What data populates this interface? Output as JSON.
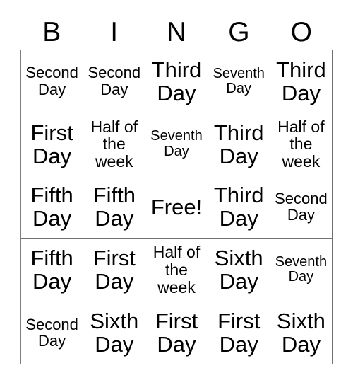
{
  "card": {
    "type": "bingo-card",
    "header_letters": [
      "B",
      "I",
      "N",
      "G",
      "O"
    ],
    "columns": 5,
    "rows": 5,
    "free_space_label": "Free!",
    "free_space_position": {
      "row": 3,
      "column": 3
    },
    "colors": {
      "background": "#ffffff",
      "text": "#000000",
      "grid_line": "#707070"
    },
    "cells": [
      [
        {
          "text": "Second Day",
          "size": "md"
        },
        {
          "text": "Second Day",
          "size": "md"
        },
        {
          "text": "Third Day",
          "size": "xl"
        },
        {
          "text": "Seventh Day",
          "size": "sm"
        },
        {
          "text": "Third Day",
          "size": "xl"
        }
      ],
      [
        {
          "text": "First Day",
          "size": "xl"
        },
        {
          "text": "Half of the week",
          "size": "lg"
        },
        {
          "text": "Seventh Day",
          "size": "sm"
        },
        {
          "text": "Third Day",
          "size": "xl"
        },
        {
          "text": "Half of the week",
          "size": "lg"
        }
      ],
      [
        {
          "text": "Fifth Day",
          "size": "xl"
        },
        {
          "text": "Fifth Day",
          "size": "xl"
        },
        {
          "text": "Free!",
          "size": "xl"
        },
        {
          "text": "Third Day",
          "size": "xl"
        },
        {
          "text": "Second Day",
          "size": "md"
        }
      ],
      [
        {
          "text": "Fifth Day",
          "size": "xl"
        },
        {
          "text": "First Day",
          "size": "xl"
        },
        {
          "text": "Half of the week",
          "size": "lg"
        },
        {
          "text": "Sixth Day",
          "size": "xl"
        },
        {
          "text": "Seventh Day",
          "size": "sm"
        }
      ],
      [
        {
          "text": "Second Day",
          "size": "md"
        },
        {
          "text": "Sixth Day",
          "size": "xl"
        },
        {
          "text": "First Day",
          "size": "xl"
        },
        {
          "text": "First Day",
          "size": "xl"
        },
        {
          "text": "Sixth Day",
          "size": "xl"
        }
      ]
    ]
  }
}
